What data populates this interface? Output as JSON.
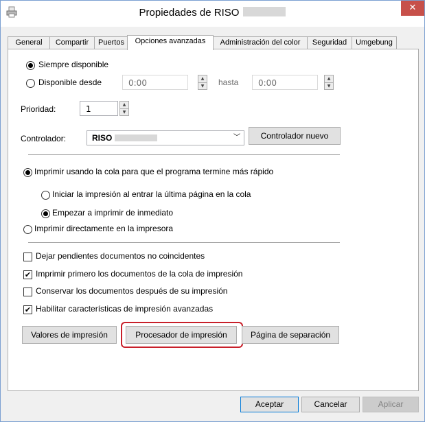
{
  "window": {
    "title": "Propiedades de RISO",
    "close_glyph": "✕"
  },
  "tabs": [
    "General",
    "Compartir",
    "Puertos",
    "Opciones avanzadas",
    "Administración del color",
    "Seguridad",
    "Umgebung"
  ],
  "availability": {
    "always_label": "Siempre disponible",
    "from_label": "Disponible desde",
    "from_value": "0:00",
    "until_label": "hasta",
    "until_value": "0:00",
    "selected": "always"
  },
  "priority": {
    "label": "Prioridad:",
    "value": "1"
  },
  "driver": {
    "label": "Controlador:",
    "value": "RISO",
    "new_button": "Controlador nuevo"
  },
  "spool": {
    "use_spool_label": "Imprimir usando la cola para que el programa termine más rápido",
    "start_last_page_label": "Iniciar la impresión al entrar la última página en la cola",
    "start_immediately_label": "Empezar a imprimir de inmediato",
    "direct_label": "Imprimir directamente en la impresora"
  },
  "options": [
    {
      "label": "Dejar pendientes documentos no coincidentes",
      "checked": false
    },
    {
      "label": "Imprimir primero los documentos de la cola de impresión",
      "checked": true
    },
    {
      "label": "Conservar los documentos después de su impresión",
      "checked": false
    },
    {
      "label": "Habilitar características de impresión avanzadas",
      "checked": true
    }
  ],
  "buttons": {
    "defaults": "Valores de impresión",
    "processor": "Procesador de impresión",
    "separator": "Página de separación"
  },
  "dialog": {
    "ok": "Aceptar",
    "cancel": "Cancelar",
    "apply": "Aplicar"
  },
  "colors": {
    "highlight": "#c8202a",
    "close": "#c7504a"
  },
  "icons": {
    "app": "printer-icon",
    "check": "✔"
  }
}
